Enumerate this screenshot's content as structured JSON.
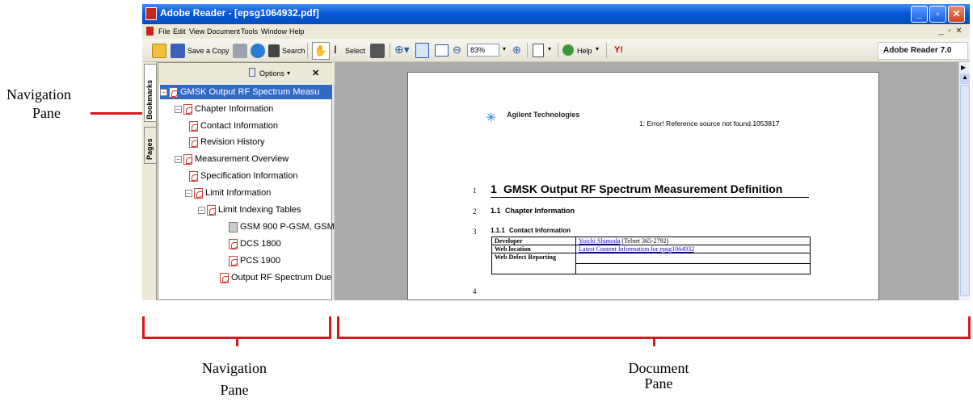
{
  "window": {
    "title": "Adobe Reader - [epsg1064932.pdf]"
  },
  "menu": [
    "File",
    "Edit",
    "View",
    "Document",
    "Tools",
    "Window",
    "Help"
  ],
  "toolbar": {
    "save_copy": "Save a Copy",
    "search": "Search",
    "select": "Select",
    "zoom": "83%",
    "help": "Help",
    "logo": "Adobe Reader 7.0"
  },
  "nav": {
    "options": "Options",
    "tab_bookmarks": "Bookmarks",
    "tab_pages": "Pages",
    "bookmarks": [
      "GMSK Output RF Spectrum Measu",
      "Chapter Information",
      "Contact Information",
      "Revision History",
      "Measurement Overview",
      "Specification Information",
      "Limit Information",
      "Limit Indexing Tables",
      "GSM 900 P-GSM, GSM",
      "DCS 1800",
      "PCS 1900",
      "Output RF Spectrum Due t"
    ]
  },
  "document": {
    "company": "Agilent Technologies",
    "header_ref": "1: Error! Reference source not found.1053817",
    "lines": [
      "1",
      "2",
      "3",
      "4"
    ],
    "h1_num": "1",
    "h1": "GMSK Output RF Spectrum Measurement Definition",
    "h2_num": "1.1",
    "h2": "Chapter Information",
    "h3_num": "1.1.1",
    "h3": "Contact Information",
    "table": [
      [
        "Developer",
        "Yoichi Shimoda",
        "(Telnet 365-2792)"
      ],
      [
        "Web location",
        "Latest Content Information for epsg1064932",
        ""
      ],
      [
        "Web Defect Reporting",
        "",
        ""
      ]
    ]
  },
  "annotations": {
    "nav_left_1": "Navigation",
    "nav_left_2": "Pane",
    "nav_bottom_1": "Navigation",
    "nav_bottom_2": "Pane",
    "doc_bottom_1": "Document",
    "doc_bottom_2": "Pane"
  }
}
